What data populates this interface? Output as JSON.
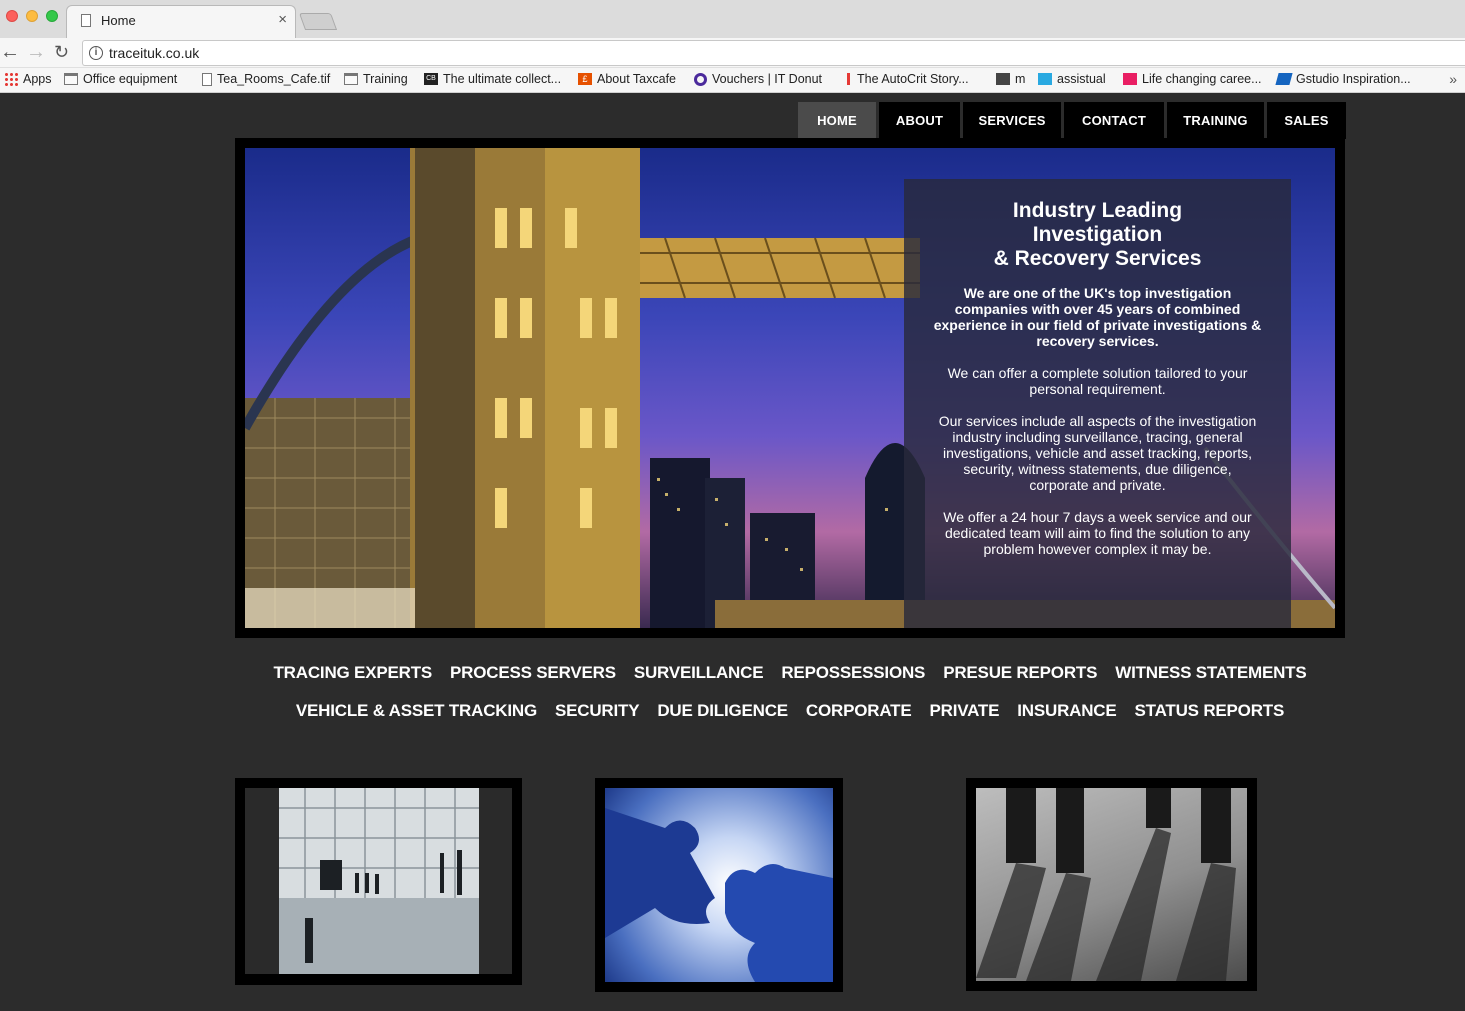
{
  "browser": {
    "tab_title": "Home",
    "tab_close": "×",
    "url": "traceituk.co.uk",
    "info_glyph": "i",
    "back_glyph": "←",
    "forward_glyph": "→",
    "reload_glyph": "↻",
    "bookmarks": [
      {
        "label": "Apps",
        "icon": "apps-grid-icon"
      },
      {
        "label": "Office equipment",
        "icon": "folder-icon"
      },
      {
        "label": "Tea_Rooms_Cafe.tif",
        "icon": "document-icon"
      },
      {
        "label": "Training",
        "icon": "folder-icon"
      },
      {
        "label": "The ultimate collect...",
        "icon": "cb-favicon"
      },
      {
        "label": "About Taxcafe",
        "icon": "taxcafe-favicon"
      },
      {
        "label": "Vouchers | IT Donut",
        "icon": "itdonut-favicon"
      },
      {
        "label": "The AutoCrit Story...",
        "icon": "autocrit-favicon"
      },
      {
        "label": "m",
        "icon": "box-favicon"
      },
      {
        "label": "assistual",
        "icon": "assistual-favicon"
      },
      {
        "label": "Life changing caree...",
        "icon": "life-favicon"
      },
      {
        "label": "Gstudio Inspiration...",
        "icon": "gstudio-favicon"
      }
    ],
    "bookmarks_more": "»",
    "cb_text": "CB",
    "tax_text": "£"
  },
  "nav": {
    "items": [
      "HOME",
      "ABOUT",
      "SERVICES",
      "CONTACT",
      "TRAINING",
      "SALES"
    ],
    "active": "HOME"
  },
  "hero": {
    "title_lines": [
      "Industry Leading",
      "Investigation",
      "& Recovery Services"
    ],
    "paragraphs": [
      "We are one of the UK's top investigation companies with over 45 years of combined experience in our field of private investigations & recovery services.",
      "We can offer a complete solution tailored to your personal requirement.",
      "Our services include all aspects of the investigation industry including surveillance, tracing, general investigations, vehicle and asset tracking, reports, security, witness statements, due diligence, corporate and private.",
      "We offer a 24 hour 7 days a week service and our dedicated team will aim  to find the solution to any problem however complex it may be."
    ]
  },
  "services": {
    "row1": [
      "TRACING EXPERTS",
      "PROCESS SERVERS",
      "SURVEILLANCE",
      "REPOSSESSIONS",
      "PRESUE REPORTS",
      "WITNESS STATEMENTS"
    ],
    "row2": [
      "VEHICLE & ASSET TRACKING",
      "SECURITY",
      "DUE DILIGENCE",
      "CORPORATE",
      "PRIVATE",
      "INSURANCE",
      "STATUS REPORTS"
    ]
  },
  "colors": {
    "page_bg": "#2c2c2c",
    "nav_bg": "#000000",
    "nav_active": "#4b4b4b",
    "panel_bg": "rgba(40,42,60,0.82)"
  }
}
